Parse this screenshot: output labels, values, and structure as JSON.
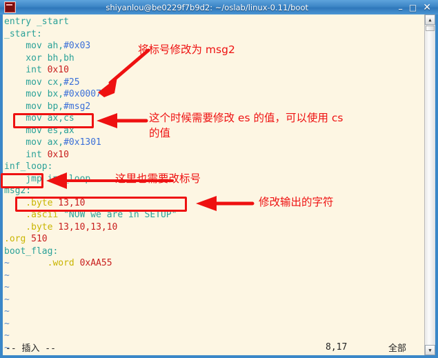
{
  "window": {
    "title": "shiyanlou@be0229f7b9d2: ~/oslab/linux-0.11/boot",
    "icon": "terminal-icon",
    "buttons": {
      "minimize": "–",
      "maximize": "□",
      "close": "✕"
    },
    "titlebar_color": "#3d86c6",
    "background_color": "#fdf6e3"
  },
  "editor": {
    "lines": [
      {
        "segments": [
          {
            "t": "entry _start",
            "c": "c-id"
          }
        ]
      },
      {
        "segments": [
          {
            "t": "_start:",
            "c": "c-id"
          }
        ]
      },
      {
        "segments": [
          {
            "t": "    mov ah,",
            "c": "c-id"
          },
          {
            "t": "#0x03",
            "c": "c-num"
          }
        ]
      },
      {
        "segments": [
          {
            "t": "    xor bh,bh",
            "c": "c-id"
          }
        ]
      },
      {
        "segments": [
          {
            "t": "    int ",
            "c": "c-id"
          },
          {
            "t": "0x10",
            "c": "c-red"
          }
        ]
      },
      {
        "segments": [
          {
            "t": "    mov cx,",
            "c": "c-id"
          },
          {
            "t": "#25",
            "c": "c-num"
          }
        ]
      },
      {
        "segments": [
          {
            "t": "    mov bx,",
            "c": "c-id"
          },
          {
            "t": "#0x0007",
            "c": "c-num"
          }
        ]
      },
      {
        "segments": [
          {
            "t": "    mov bp,",
            "c": "c-id"
          },
          {
            "t": "#msg2",
            "c": "c-num"
          }
        ]
      },
      {
        "segments": [
          {
            "t": "    mov ax,cs",
            "c": "c-id"
          }
        ]
      },
      {
        "segments": [
          {
            "t": "    mov es,ax",
            "c": "c-id"
          }
        ]
      },
      {
        "segments": [
          {
            "t": "    mov ax,",
            "c": "c-id"
          },
          {
            "t": "#0x1301",
            "c": "c-num"
          }
        ]
      },
      {
        "segments": [
          {
            "t": "    int ",
            "c": "c-id"
          },
          {
            "t": "0x10",
            "c": "c-red"
          }
        ]
      },
      {
        "segments": [
          {
            "t": "inf_loop:",
            "c": "c-id"
          }
        ]
      },
      {
        "segments": [
          {
            "t": "    jmp inf_loop",
            "c": "c-id"
          }
        ]
      },
      {
        "segments": [
          {
            "t": "msg2:",
            "c": "c-id"
          }
        ]
      },
      {
        "segments": [
          {
            "t": "    .byte ",
            "c": "c-dir"
          },
          {
            "t": "13,10",
            "c": "c-red"
          }
        ]
      },
      {
        "segments": [
          {
            "t": "    .ascii ",
            "c": "c-dir"
          },
          {
            "t": "\"NOW we are in SETUP\"",
            "c": "c-str"
          }
        ]
      },
      {
        "segments": [
          {
            "t": "    .byte ",
            "c": "c-dir"
          },
          {
            "t": "13,10,13,10",
            "c": "c-red"
          }
        ]
      },
      {
        "segments": [
          {
            "t": ".org ",
            "c": "c-dir"
          },
          {
            "t": "510",
            "c": "c-red"
          }
        ]
      },
      {
        "segments": [
          {
            "t": "boot_flag:",
            "c": "c-id"
          }
        ]
      },
      {
        "segments": [
          {
            "t": "        .word ",
            "c": "c-dir"
          },
          {
            "t": "0xAA55",
            "c": "c-red"
          }
        ]
      }
    ],
    "empty_line_marker": "~",
    "empty_line_count": 8
  },
  "status": {
    "mode": "-- 插入 --",
    "position": "8,17",
    "percent": "全部"
  },
  "annotations": [
    {
      "id": "annotation-label-msg2",
      "text": "将标号修改为 msg2"
    },
    {
      "id": "annotation-es-value",
      "text": "这个时候需要修改 es 的值，可以使用 cs\n的值"
    },
    {
      "id": "annotation-label-here",
      "text": "这里也需要改标号"
    },
    {
      "id": "annotation-output-string",
      "text": "修改输出的字符"
    }
  ],
  "scrollbar": {
    "up_arrow": "▲",
    "down_arrow": "▼"
  },
  "colors": {
    "annotation_red": "#ee1111",
    "keyword_teal": "#2aa198",
    "immediate_blue": "#3a6fd8",
    "number_red": "#c81e1e",
    "directive_yellow": "#c9b500",
    "tilde_blue": "#5588c8"
  }
}
